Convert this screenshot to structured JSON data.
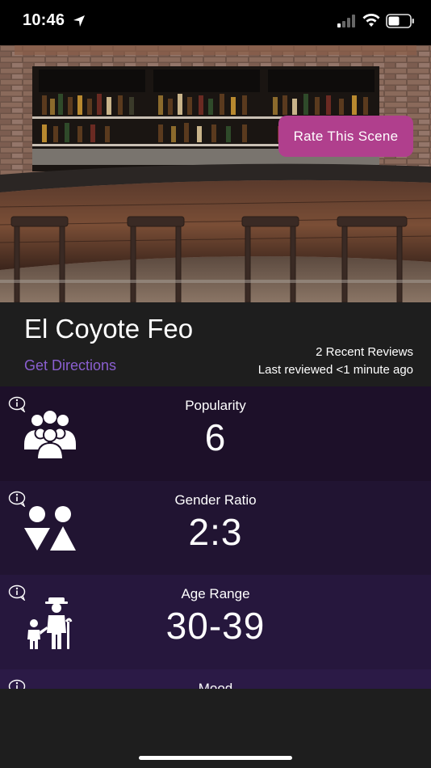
{
  "status_bar": {
    "time": "10:46"
  },
  "hero": {
    "rate_button": "Rate This Scene"
  },
  "venue": {
    "name": "El Coyote Feo",
    "directions_link": "Get Directions",
    "recent_reviews": "2 Recent Reviews",
    "last_reviewed": "Last reviewed <1 minute ago"
  },
  "stats": [
    {
      "label": "Popularity",
      "value": "6",
      "icon": "crowd-icon"
    },
    {
      "label": "Gender Ratio",
      "value": "2:3",
      "icon": "gender-icon"
    },
    {
      "label": "Age Range",
      "value": "30-39",
      "icon": "age-icon"
    },
    {
      "label": "Mood",
      "icon": "mood-icon"
    }
  ],
  "colors": {
    "accent_button": "#b03f8d",
    "link": "#8a5fd0"
  }
}
